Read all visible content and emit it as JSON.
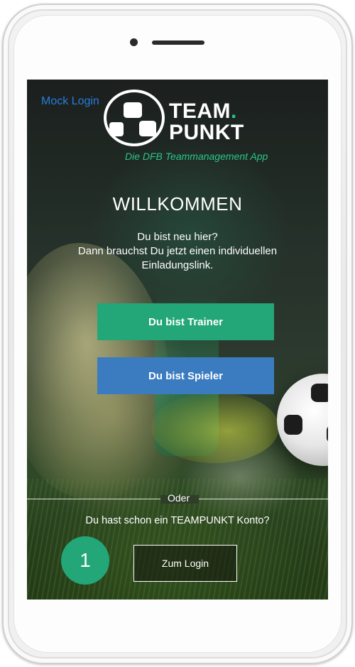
{
  "app": {
    "mock_login_label": "Mock Login",
    "logo": {
      "line1": "TEAM",
      "line1_dot": ".",
      "line2": "PUNKT",
      "tagline": "Die DFB Teammanagement App"
    },
    "welcome_title": "WILLKOMMEN",
    "intro_lines": [
      "Du bist neu hier?",
      "Dann brauchst Du jetzt einen individuellen",
      "Einladungslink."
    ],
    "buttons": {
      "trainer": "Du bist Trainer",
      "spieler": "Du bist Spieler"
    },
    "divider_label": "Oder",
    "account_question": "Du hast schon ein TEAMPUNKT Konto?",
    "step_badge": "1",
    "login_button": "Zum Login"
  },
  "colors": {
    "green": "#23a678",
    "blue": "#3b7cc1",
    "link_blue": "#2a7bdb",
    "tagline_green": "#2bc48b"
  }
}
